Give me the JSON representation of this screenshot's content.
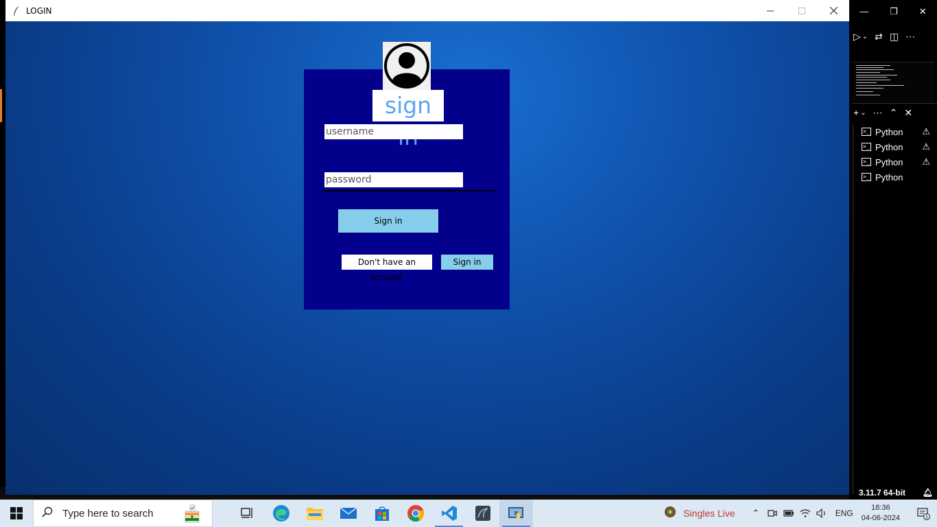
{
  "login_window": {
    "title": "LOGIN",
    "heading": "sign in",
    "username_placeholder": "username",
    "password_placeholder": "password",
    "signin_button": "Sign in",
    "no_account_label": "Don't have an account",
    "signin_link_button": "Sign in"
  },
  "vscode": {
    "terminals": [
      {
        "label": "Python",
        "warning": true
      },
      {
        "label": "Python",
        "warning": true
      },
      {
        "label": "Python",
        "warning": true
      },
      {
        "label": "Python",
        "warning": false
      }
    ],
    "python_version": "3.11.7 64-bit"
  },
  "taskbar": {
    "search_placeholder": "Type here to search",
    "news_text": "Singles Live",
    "language": "ENG",
    "time": "18:36",
    "date": "04-06-2024",
    "notification_count": "1"
  },
  "colors": {
    "panel": "#03008b",
    "button": "#87ceeb",
    "heading_text": "#5aa6f0"
  }
}
